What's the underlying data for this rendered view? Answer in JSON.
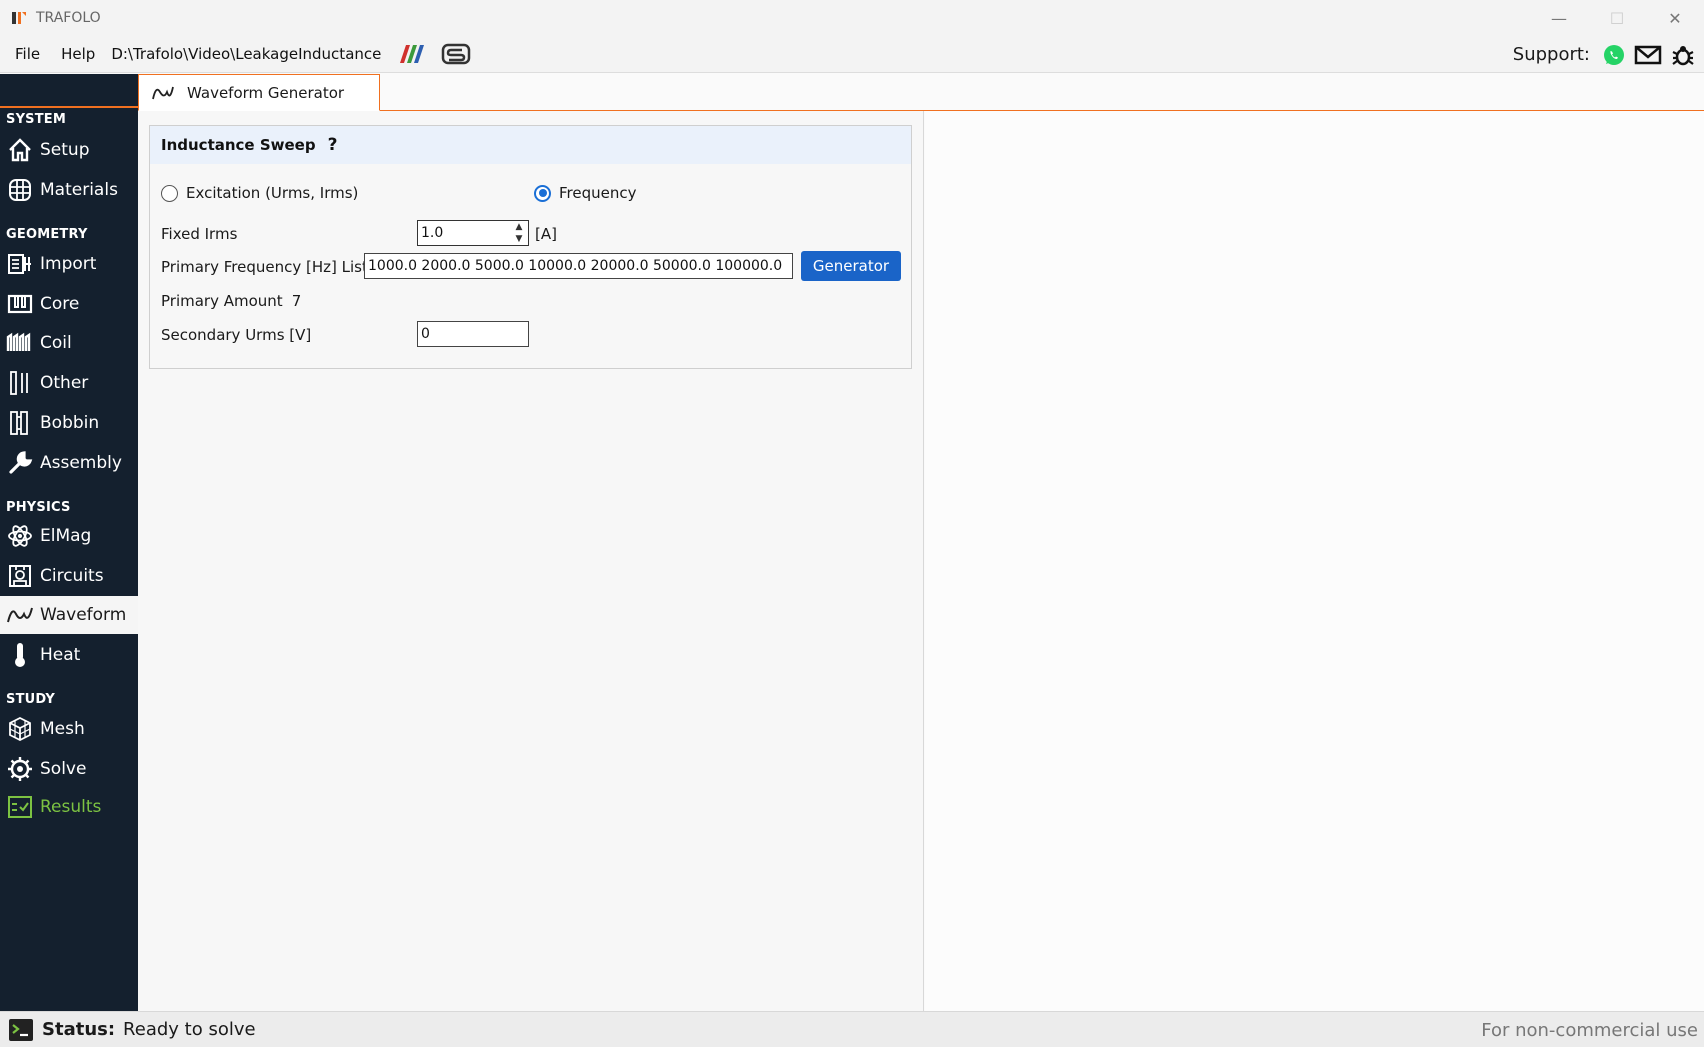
{
  "window": {
    "title": "TRAFOLO",
    "controls": {
      "minimize": "—",
      "maximize": "☐",
      "close": "✕"
    }
  },
  "menubar": {
    "file": "File",
    "help": "Help",
    "path": "D:\\Trafolo\\Video\\LeakageInductance",
    "support_label": "Support:"
  },
  "sidebar": {
    "sections": {
      "system": "SYSTEM",
      "geometry": "GEOMETRY",
      "physics": "PHYSICS",
      "study": "STUDY"
    },
    "items": {
      "setup": "Setup",
      "materials": "Materials",
      "import": "Import",
      "core": "Core",
      "coil": "Coil",
      "other": "Other",
      "bobbin": "Bobbin",
      "assembly": "Assembly",
      "elmag": "ElMag",
      "circuits": "Circuits",
      "waveform": "Waveform",
      "heat": "Heat",
      "mesh": "Mesh",
      "solve": "Solve",
      "results": "Results"
    },
    "active": "waveform"
  },
  "tabs": [
    {
      "label": "Waveform Generator",
      "icon": "sine-wave-icon"
    }
  ],
  "panel": {
    "title": "Inductance Sweep",
    "help": "?",
    "radio_excitation": "Excitation (Urms, Irms)",
    "radio_frequency": "Frequency",
    "selected_mode": "Frequency",
    "fixed_irms_label": "Fixed Irms",
    "fixed_irms_value": "1.0",
    "fixed_irms_unit": "[A]",
    "primary_freq_label": "Primary Frequency [Hz] List",
    "primary_freq_value": "1000.0 2000.0 5000.0 10000.0 20000.0 50000.0 100000.0",
    "generator_button": "Generator",
    "primary_amount_label": "Primary Amount",
    "primary_amount_value": "7",
    "secondary_urms_label": "Secondary Urms [V]",
    "secondary_urms_value": "0"
  },
  "status": {
    "label": "Status:",
    "text": "Ready to solve",
    "right": "For non-commercial use"
  },
  "colors": {
    "sidebar_bg": "#14202e",
    "accent_orange": "#f07020",
    "button_blue": "#1a64c8",
    "results_green": "#7cc242",
    "whatsapp_green": "#25d366"
  }
}
